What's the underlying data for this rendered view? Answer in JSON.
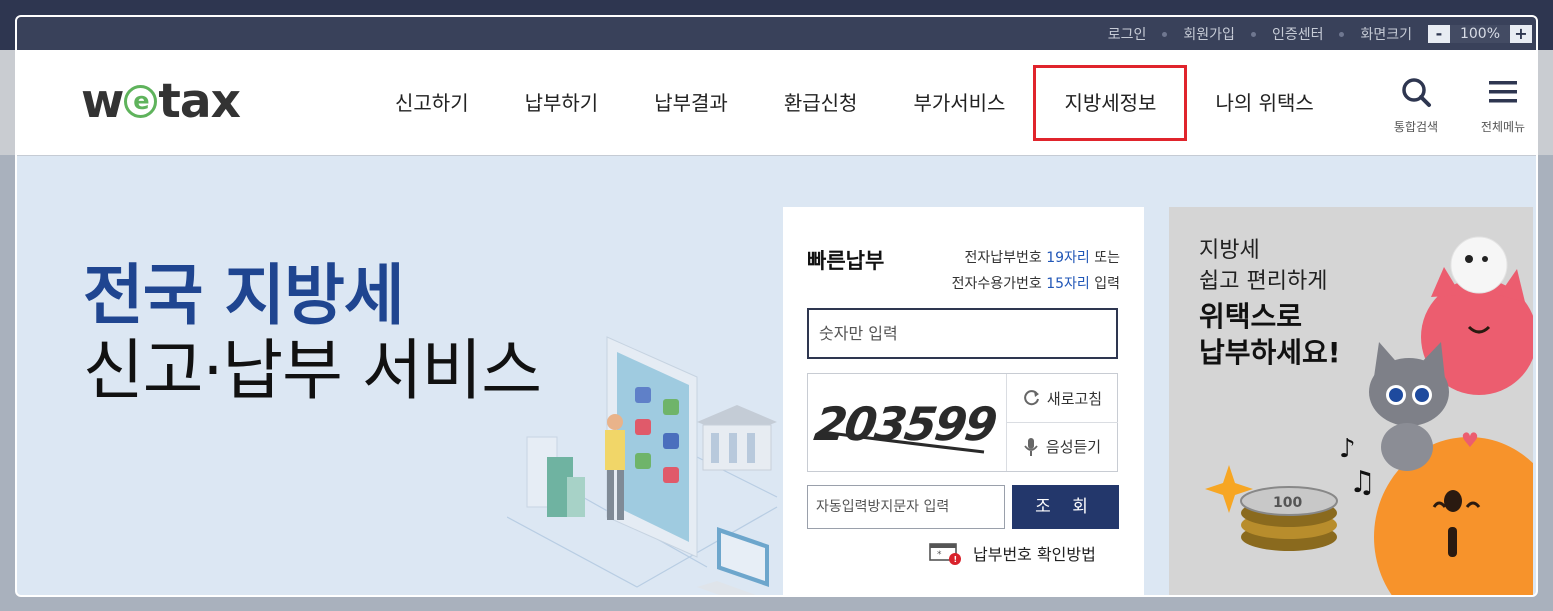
{
  "util": {
    "login": "로그인",
    "signup": "회원가입",
    "cert": "인증센터",
    "screen_size": "화면크기",
    "zoom_minus": "-",
    "zoom_value": "100%",
    "zoom_plus": "+"
  },
  "header": {
    "logo_w": "w",
    "logo_e": "e",
    "logo_tax": "tax",
    "nav": [
      "신고하기",
      "납부하기",
      "납부결과",
      "환급신청",
      "부가서비스",
      "지방세정보",
      "나의 위택스"
    ],
    "search_label": "통합검색",
    "menu_label": "전체메뉴"
  },
  "hero": {
    "title_line1": "전국 지방세",
    "title_line2": "신고·납부 서비스"
  },
  "quick_pay": {
    "title": "빠른납부",
    "desc_part1": "전자납부번호 ",
    "desc_blue1": "19자리",
    "desc_part2": " 또는",
    "desc_part3": "전자수용가번호 ",
    "desc_blue2": "15자리",
    "desc_part4": " 입력",
    "number_placeholder": "숫자만 입력",
    "captcha_text": "203599",
    "refresh_label": "새로고침",
    "audio_label": "음성듣기",
    "auto_input_placeholder": "자동입력방지문자 입력",
    "search_button": "조 회",
    "confirm_method": "납부번호 확인방법"
  },
  "banner": {
    "line1": "지방세",
    "line2": "쉽고 편리하게",
    "line3": "위택스로",
    "line4": "납부하세요!",
    "coin_text": "100"
  },
  "colors": {
    "topbar": "#2e3650",
    "hero_bg": "#dce7f3",
    "accent_blue": "#1f4590",
    "highlight_red": "#e0242c",
    "button_navy": "#23376b",
    "logo_green": "#5fb35c"
  }
}
